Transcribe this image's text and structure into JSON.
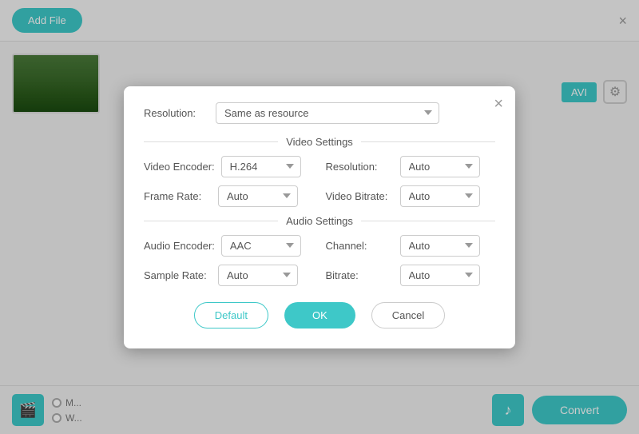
{
  "app": {
    "add_file_label": "Add File",
    "close_label": "×"
  },
  "toolbar": {
    "convert_label": "Convert",
    "avi_label": "AVI"
  },
  "modal": {
    "close_label": "×",
    "resolution_label": "Resolution:",
    "resolution_value": "Same as resource",
    "video_settings_label": "Video Settings",
    "audio_settings_label": "Audio Settings",
    "video_encoder_label": "Video Encoder:",
    "video_encoder_value": "H.264",
    "resolution_label2": "Resolution:",
    "resolution_value2": "Auto",
    "frame_rate_label": "Frame Rate:",
    "frame_rate_value": "Auto",
    "video_bitrate_label": "Video Bitrate:",
    "video_bitrate_value": "Auto",
    "audio_encoder_label": "Audio Encoder:",
    "audio_encoder_value": "AAC",
    "channel_label": "Channel:",
    "channel_value": "Auto",
    "sample_rate_label": "Sample Rate:",
    "sample_rate_value": "Auto",
    "bitrate_label": "Bitrate:",
    "bitrate_value": "Auto",
    "default_label": "Default",
    "ok_label": "OK",
    "cancel_label": "Cancel"
  },
  "bottom": {
    "radio1": "M...",
    "radio2": "W...",
    "film_icon": "🎬",
    "music_icon": "♪",
    "gear_icon": "⚙"
  }
}
